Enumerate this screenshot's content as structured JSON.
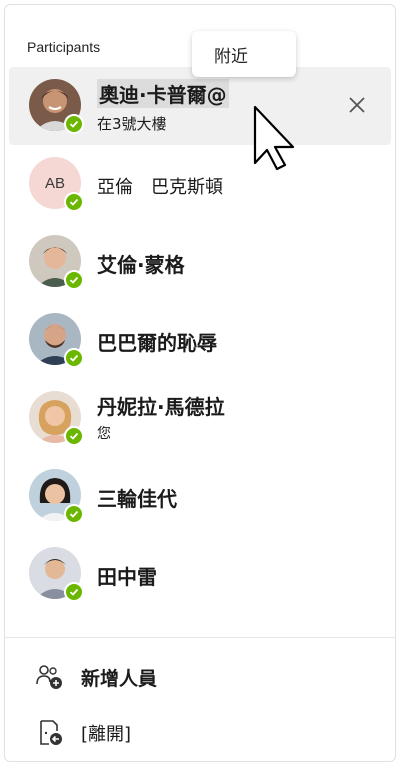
{
  "header": {
    "title": "Participants"
  },
  "tooltip": {
    "text": "附近"
  },
  "participants": [
    {
      "name": "奧迪·卡普爾@",
      "subtitle": "在3號大樓",
      "status": "available",
      "selected": true
    },
    {
      "name": "亞倫　巴克斯頓",
      "initials": "AB",
      "status": "available"
    },
    {
      "name": "艾倫·蒙格",
      "status": "available"
    },
    {
      "name": "巴巴爾的恥辱",
      "status": "available"
    },
    {
      "name": "丹妮拉·馬德拉",
      "subtitle": "您",
      "status": "available"
    },
    {
      "name": "三輪佳代",
      "status": "available"
    },
    {
      "name": "田中雷",
      "status": "available"
    }
  ],
  "actions": {
    "add_people": "新增人員",
    "leave": "[離開]"
  },
  "colors": {
    "status_available": "#6bb700",
    "selected_row": "#f0f0f0",
    "initials_bg": "#f5d7d3"
  },
  "icons": {
    "close": "close-icon",
    "add_people": "add-people-icon",
    "leave": "leave-icon",
    "status": "checkmark-icon"
  }
}
